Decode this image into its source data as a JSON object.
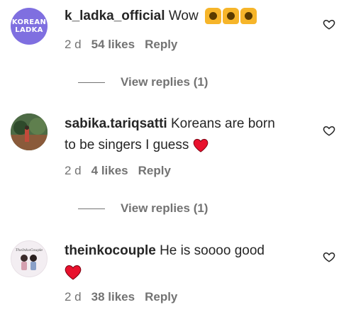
{
  "comments": [
    {
      "avatar_text": [
        "KOREAN",
        "LADKA"
      ],
      "username": "k_ladka_official",
      "text": "Wow",
      "emoji": "raising-hands x3",
      "time": "2 d",
      "likes": "54 likes",
      "reply": "Reply",
      "view_replies": "View replies (1)"
    },
    {
      "username": "sabika.tariqsatti",
      "text_line1": "Koreans are born",
      "text_line2": "to be singers I guess",
      "emoji": "red-heart",
      "time": "2 d",
      "likes": "4 likes",
      "reply": "Reply",
      "view_replies": "View replies (1)"
    },
    {
      "avatar_text": "TheInkoCouple",
      "username": "theinkocouple",
      "text": "He is soooo good",
      "emoji": "red-heart",
      "time": "2 d",
      "likes": "38 likes",
      "reply": "Reply"
    }
  ],
  "icons": {
    "like": "heart-outline-icon",
    "emoji_hands": "raising-hands-icon",
    "emoji_heart": "red-heart-icon"
  },
  "colors": {
    "text": "#262626",
    "muted": "#737373",
    "heart_red": "#e8112d",
    "avatar1_bg": "#7f6fe0"
  }
}
